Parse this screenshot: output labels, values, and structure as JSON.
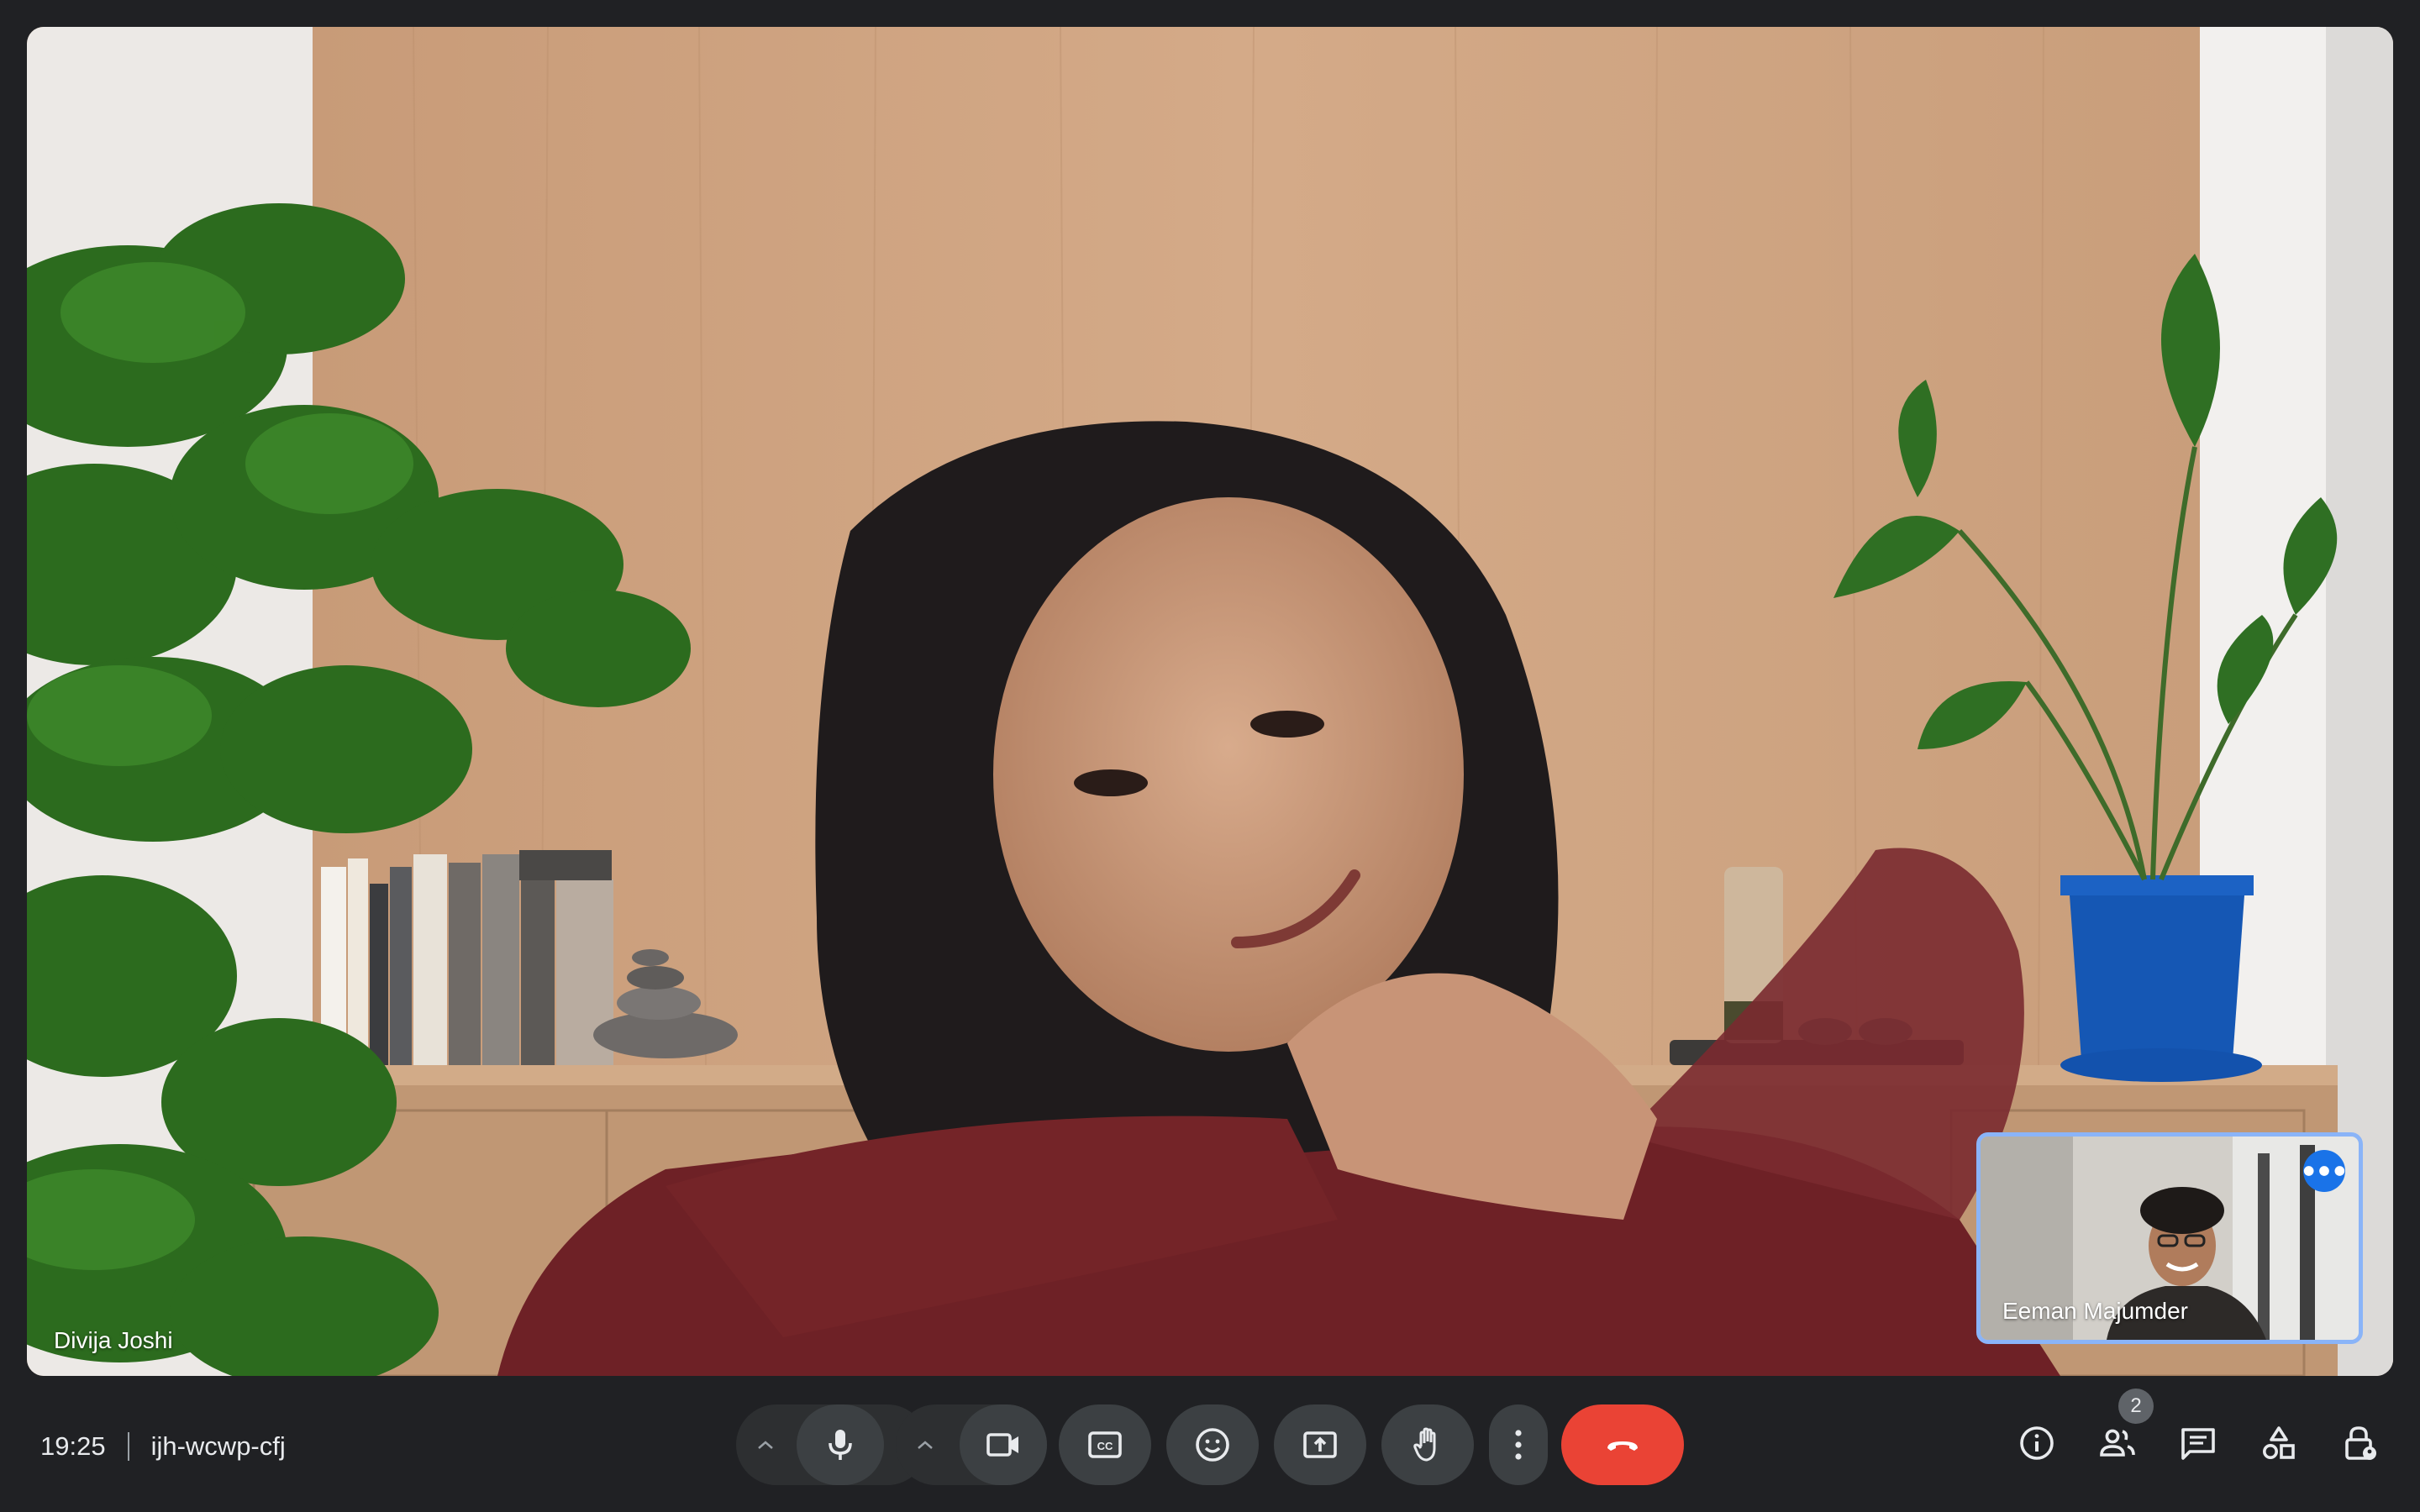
{
  "meeting": {
    "time": "19:25",
    "code": "ijh-wcwp-cfj"
  },
  "participants": {
    "main": {
      "name": "Divija Joshi"
    },
    "self": {
      "name": "Eeman Majumder"
    },
    "count": "2"
  },
  "controls": {
    "mic": {
      "icon": "microphone-icon",
      "state": "on"
    },
    "camera": {
      "icon": "video-camera-icon",
      "state": "on"
    },
    "captions": {
      "icon": "closed-captions-icon"
    },
    "reactions": {
      "icon": "emoji-icon"
    },
    "present": {
      "icon": "present-screen-icon"
    },
    "raise_hand": {
      "icon": "raise-hand-icon"
    },
    "more": {
      "icon": "more-vert-icon"
    },
    "end_call": {
      "icon": "end-call-icon"
    }
  },
  "right_panel": [
    {
      "icon": "info-icon"
    },
    {
      "icon": "people-icon"
    },
    {
      "icon": "chat-icon"
    },
    {
      "icon": "activities-icon"
    },
    {
      "icon": "host-controls-icon"
    }
  ],
  "colors": {
    "background": "#202124",
    "control_bg": "#3c4043",
    "end_call": "#ea4335",
    "self_border": "#8ab4f8",
    "accent": "#1a73e8"
  }
}
